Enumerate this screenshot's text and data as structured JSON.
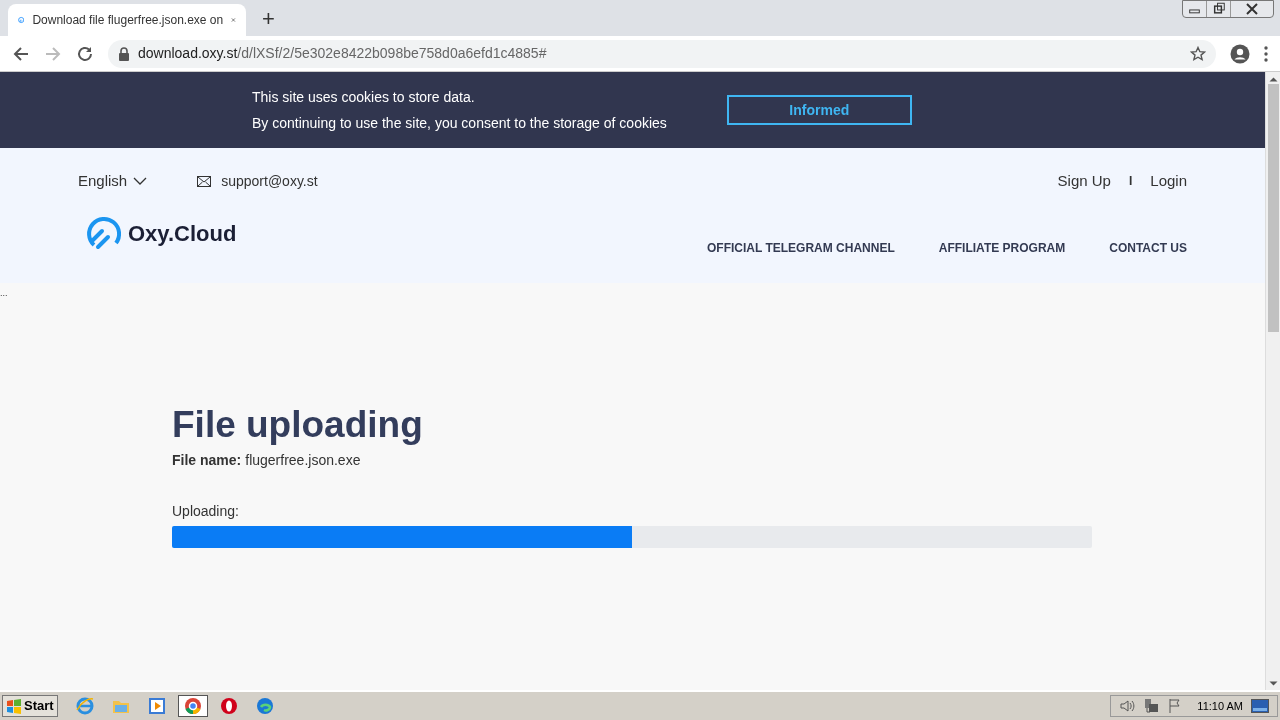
{
  "browser": {
    "tab": {
      "title": "Download file flugerfree.json.exe on",
      "selected": true
    },
    "new_tab": "+",
    "url_host": "download.oxy.st",
    "url_path": "/d/lXSf/2/5e302e8422b098be758d0a6efd1c4885#"
  },
  "cookie_banner": {
    "lines": [
      "This site uses cookies to store data.",
      "By continuing to use the site, you consent to the storage of cookies"
    ],
    "button": "Informed"
  },
  "header": {
    "language": "English",
    "email": "support@oxy.st",
    "auth": [
      "Sign Up",
      "Login"
    ],
    "separator": "I",
    "logo": "Oxy.Cloud",
    "nav": [
      "OFFICIAL TELEGRAM CHANNEL",
      "AFFILIATE PROGRAM",
      "CONTACT US"
    ]
  },
  "ellipsis": "...",
  "upload": {
    "title": "File uploading",
    "file_label": "File name:",
    "file_name": "flugerfree.json.exe",
    "progress_label": "Uploading:",
    "level": 0.5
  },
  "taskbar": {
    "start": "Start",
    "apps": [
      {
        "kind": "ie",
        "selected": false
      },
      {
        "kind": "folder",
        "selected": false
      },
      {
        "kind": "media",
        "selected": false
      },
      {
        "kind": "chrome",
        "selected": true
      },
      {
        "kind": "opera",
        "selected": false
      },
      {
        "kind": "edge",
        "selected": false
      }
    ],
    "clock": "11:10 AM"
  }
}
